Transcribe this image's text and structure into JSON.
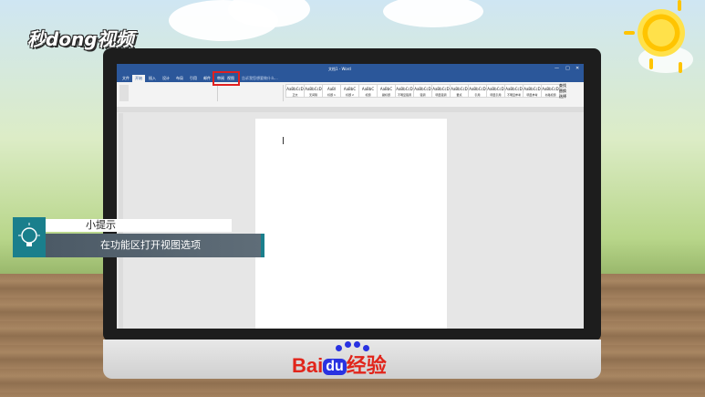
{
  "branding": {
    "watermark_text": "秒dong视频",
    "footer_brand_bai": "Bai",
    "footer_brand_du": "du",
    "footer_brand_suffix": "经验"
  },
  "word_window": {
    "title": "文档1 - Word",
    "tabs": [
      "文件",
      "开始",
      "插入",
      "设计",
      "布局",
      "引用",
      "邮件",
      "审阅",
      "视图"
    ],
    "active_tab": "开始",
    "highlighted_tab": "视图",
    "search_hint": "告诉我您想要做什么...",
    "styles": [
      {
        "preview": "AaBbCcD",
        "name": "正文"
      },
      {
        "preview": "AaBbCcD",
        "name": "无间隔"
      },
      {
        "preview": "AaBl",
        "name": "标题 1"
      },
      {
        "preview": "AaBbC",
        "name": "标题 2"
      },
      {
        "preview": "AaBbC",
        "name": "标题"
      },
      {
        "preview": "AaBbC",
        "name": "副标题"
      },
      {
        "preview": "AaBbCcD",
        "name": "不明显强调"
      },
      {
        "preview": "AaBbCcD",
        "name": "强调"
      },
      {
        "preview": "AaBbCcD",
        "name": "明显强调"
      },
      {
        "preview": "AaBbCcD",
        "name": "要点"
      },
      {
        "preview": "AaBbCcD",
        "name": "引用"
      },
      {
        "preview": "AaBbCcD",
        "name": "明显引用"
      },
      {
        "preview": "AaBbCcD",
        "name": "不明显参考"
      },
      {
        "preview": "AaBbCcD",
        "name": "明显参考"
      },
      {
        "preview": "AaBbCcD",
        "name": "书籍标题"
      }
    ],
    "editing": [
      "查找",
      "替换",
      "选择"
    ]
  },
  "tip": {
    "title": "小提示",
    "body": "在功能区打开视图选项"
  },
  "colors": {
    "word_blue": "#2b579a",
    "tip_accent": "#1a7f8c",
    "baidu_red": "#e1251b",
    "baidu_blue": "#2932e1"
  }
}
